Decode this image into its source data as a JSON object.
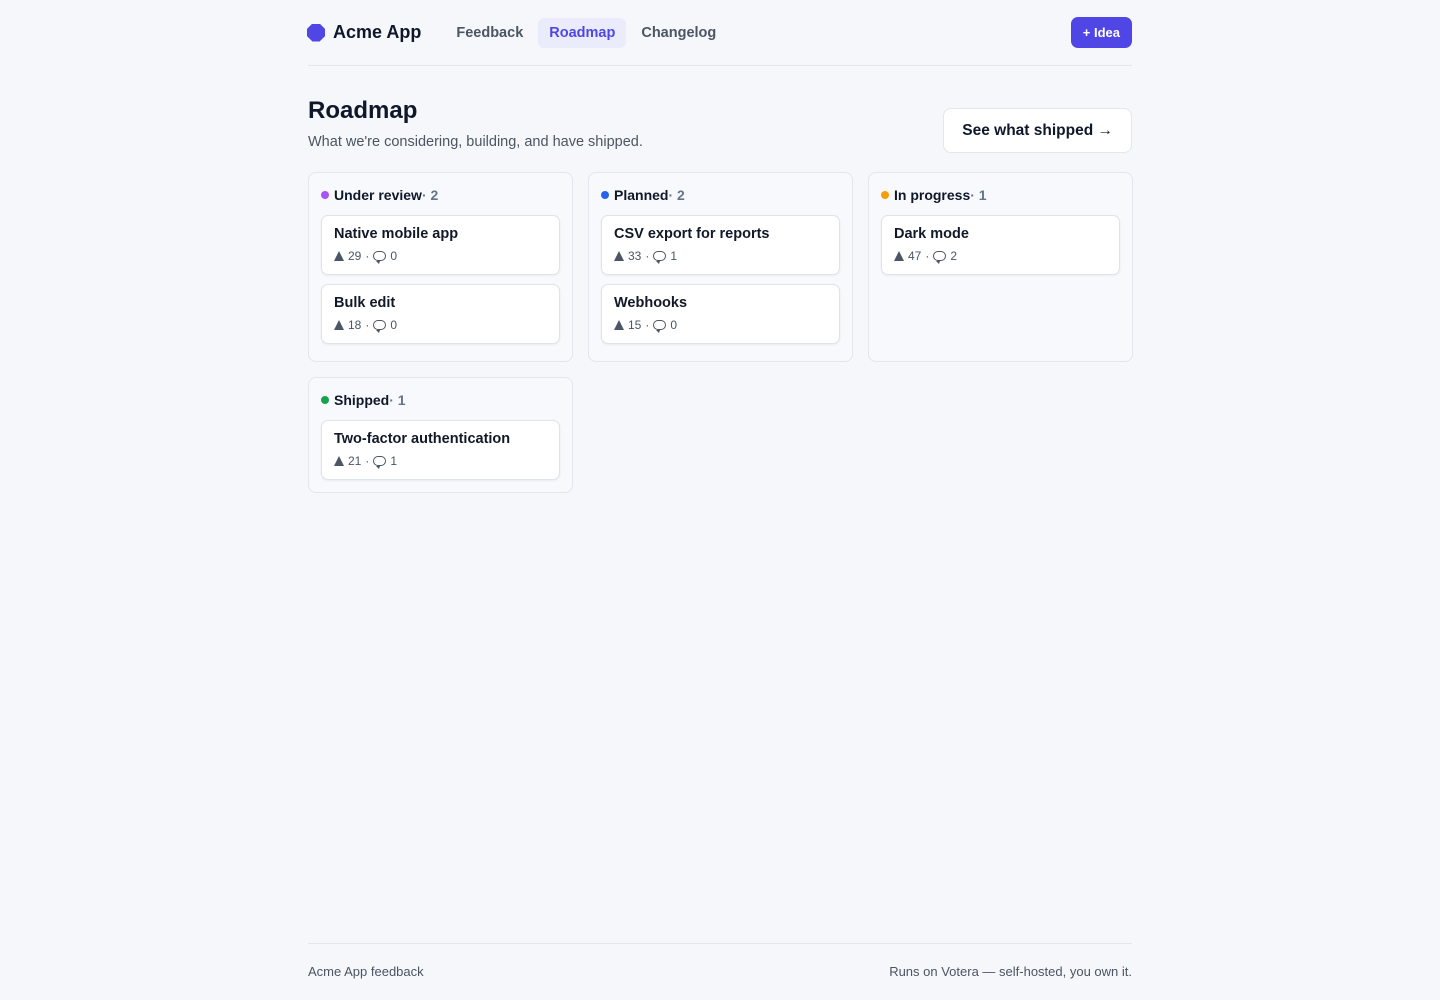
{
  "header": {
    "app_name": "Acme App",
    "nav": [
      {
        "label": "Feedback",
        "active": false
      },
      {
        "label": "Roadmap",
        "active": true
      },
      {
        "label": "Changelog",
        "active": false
      }
    ],
    "idea_button": "+ Idea"
  },
  "page": {
    "title": "Roadmap",
    "subtitle": "What we're considering, building, and have shipped.",
    "see_shipped_button": "See what shipped →"
  },
  "columns": [
    {
      "name": "Under review",
      "count_label": "· 2",
      "color": "#a855f7",
      "cards": [
        {
          "title": "Native mobile app",
          "votes": "29",
          "comments": "0"
        },
        {
          "title": "Bulk edit",
          "votes": "18",
          "comments": "0"
        }
      ]
    },
    {
      "name": "Planned",
      "count_label": "· 2",
      "color": "#2563eb",
      "cards": [
        {
          "title": "CSV export for reports",
          "votes": "33",
          "comments": "1"
        },
        {
          "title": "Webhooks",
          "votes": "15",
          "comments": "0"
        }
      ]
    },
    {
      "name": "In progress",
      "count_label": "· 1",
      "color": "#f59e0b",
      "cards": [
        {
          "title": "Dark mode",
          "votes": "47",
          "comments": "2"
        }
      ]
    },
    {
      "name": "Shipped",
      "count_label": "· 1",
      "color": "#16a34a",
      "cards": [
        {
          "title": "Two-factor authentication",
          "votes": "21",
          "comments": "1"
        }
      ]
    }
  ],
  "meta_separator": "·",
  "icons": {
    "upvote": "triangle-up-icon",
    "comments": "speech-bubble-icon",
    "brand": "octagon-logo-icon"
  },
  "footer": {
    "left": "Acme App feedback",
    "right": "Runs on Votera — self-hosted, you own it."
  }
}
